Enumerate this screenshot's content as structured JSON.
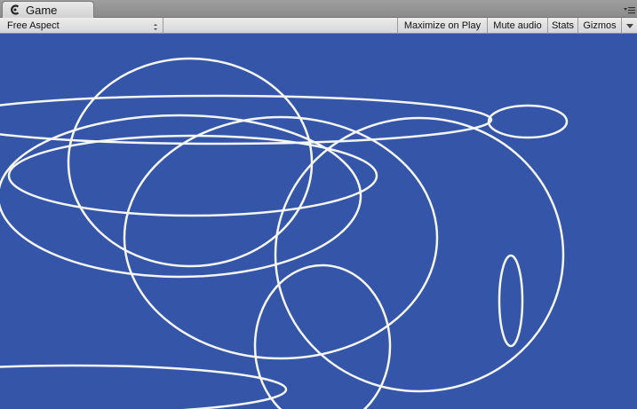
{
  "window": {
    "tab_label": "Game",
    "tab_icon": "game-controller-icon",
    "menu_icon": "window-menu-icon"
  },
  "toolbar": {
    "aspect_label": "Free Aspect",
    "maximize_label": "Maximize on Play",
    "mute_label": "Mute audio",
    "stats_label": "Stats",
    "gizmos_label": "Gizmos"
  },
  "colors": {
    "background": "#3455a8",
    "line": "#f4f6f4"
  }
}
